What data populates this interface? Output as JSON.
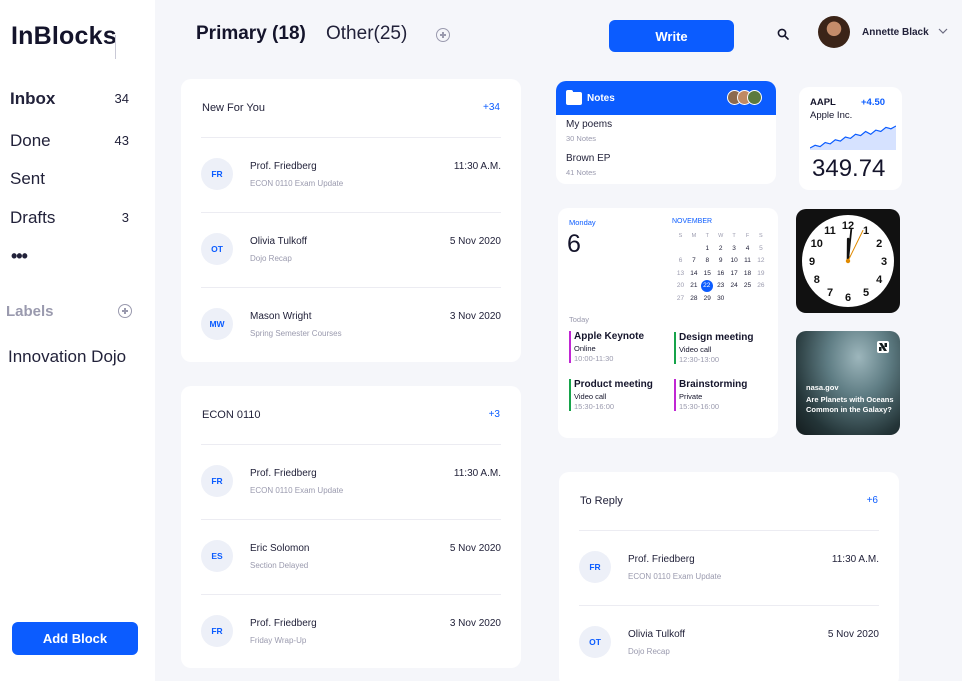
{
  "app": {
    "brand": "InBlocks"
  },
  "sidebar": {
    "items": [
      {
        "label": "Inbox",
        "count": "34"
      },
      {
        "label": "Done",
        "count": "43"
      },
      {
        "label": "Sent",
        "count": ""
      },
      {
        "label": "Drafts",
        "count": "3"
      }
    ],
    "more": "•••",
    "labels_heading": "Labels",
    "labels": [
      "Innovation Dojo"
    ],
    "add_block_label": "Add Block"
  },
  "header": {
    "tabs": [
      {
        "label": "Primary (18)",
        "active": true
      },
      {
        "label": "Other(25)",
        "active": false
      }
    ],
    "write_label": "Write",
    "user_name": "Annette Black",
    "icons": [
      "add-circle-icon",
      "search-icon",
      "chevron-down-icon"
    ]
  },
  "mail_cards": [
    {
      "title": "New For You",
      "count": "+34",
      "rows": [
        {
          "initials": "FR",
          "name": "Prof. Friedberg",
          "subject": "ECON 0110 Exam Update",
          "time": "11:30 A.M."
        },
        {
          "initials": "OT",
          "name": "Olivia Tulkoff",
          "subject": "Dojo Recap",
          "time": "5 Nov 2020"
        },
        {
          "initials": "MW",
          "name": "Mason Wright",
          "subject": "Spring Semester Courses",
          "time": "3 Nov 2020"
        }
      ]
    },
    {
      "title": "ECON 0110",
      "count": "+3",
      "rows": [
        {
          "initials": "FR",
          "name": "Prof. Friedberg",
          "subject": "ECON 0110 Exam Update",
          "time": "11:30 A.M."
        },
        {
          "initials": "ES",
          "name": "Eric Solomon",
          "subject": "Section Delayed",
          "time": "5 Nov 2020"
        },
        {
          "initials": "FR",
          "name": "Prof. Friedberg",
          "subject": "Friday Wrap-Up",
          "time": "3 Nov 2020"
        }
      ]
    },
    {
      "title": "To Reply",
      "count": "+6",
      "rows": [
        {
          "initials": "FR",
          "name": "Prof. Friedberg",
          "subject": "ECON 0110 Exam Update",
          "time": "11:30 A.M."
        },
        {
          "initials": "OT",
          "name": "Olivia Tulkoff",
          "subject": "Dojo Recap",
          "time": "5 Nov 2020"
        }
      ]
    }
  ],
  "notes": {
    "title": "Notes",
    "items": [
      {
        "name": "My poems",
        "count": "30 Notes"
      },
      {
        "name": "Brown EP",
        "count": "41 Notes"
      }
    ]
  },
  "stock": {
    "symbol": "AAPL",
    "change": "+4.50",
    "name": "Apple Inc.",
    "price": "349.74",
    "trend": [
      2,
      3,
      2.5,
      4,
      3.5,
      5,
      4.5,
      6,
      5.5,
      7,
      6.5,
      8,
      7,
      8.5,
      8,
      9.5,
      9,
      10
    ]
  },
  "calendar": {
    "day_name": "Monday",
    "day_num": "6",
    "month": "NOVEMBER",
    "weekdays": [
      "S",
      "M",
      "T",
      "W",
      "T",
      "F",
      "S"
    ],
    "weeks": [
      [
        "",
        "",
        "1",
        "2",
        "3",
        "4",
        "5"
      ],
      [
        "6",
        "7",
        "8",
        "9",
        "10",
        "11",
        "12"
      ],
      [
        "13",
        "14",
        "15",
        "16",
        "17",
        "18",
        "19"
      ],
      [
        "20",
        "21",
        "22",
        "23",
        "24",
        "25",
        "26"
      ],
      [
        "27",
        "28",
        "29",
        "30",
        "",
        "",
        ""
      ]
    ],
    "today_label": "Today",
    "highlight_day": "22",
    "events": [
      {
        "title": "Apple Keynote",
        "type": "Online",
        "time": "10:00-11:30",
        "color": "#c026d3"
      },
      {
        "title": "Design meeting",
        "type": "Video call",
        "time": "12:30-13:00",
        "color": "#16a34a"
      },
      {
        "title": "Product meeting",
        "type": "Video call",
        "time": "15:30-16:00",
        "color": "#16a34a"
      },
      {
        "title": "Brainstorming",
        "type": "Private",
        "time": "15:30-16:00",
        "color": "#c026d3"
      }
    ]
  },
  "clock": {
    "hours": 12,
    "minutes": 1
  },
  "news": {
    "source": "nasa.gov",
    "headline": "Are Planets with Oceans Common in the Galaxy?"
  },
  "colors": {
    "accent": "#0b5cff",
    "sidebar_bg": "#ffffff",
    "page_bg": "#f5f6fa"
  }
}
